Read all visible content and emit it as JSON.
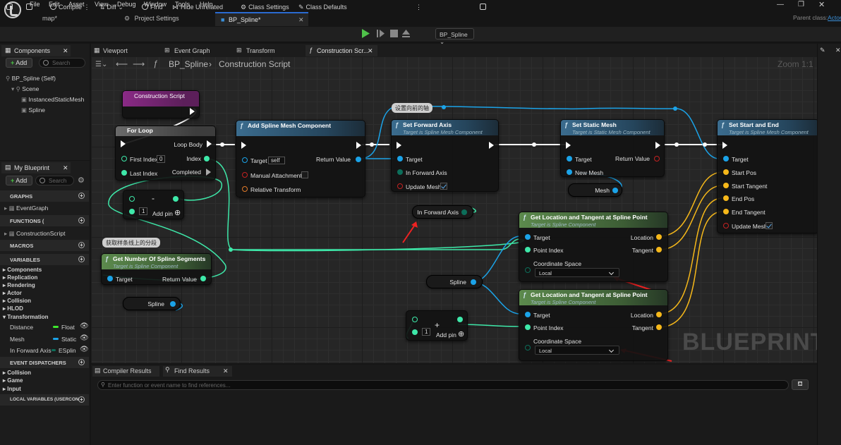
{
  "menu": {
    "items": [
      "File",
      "Edit",
      "Asset",
      "View",
      "Debug",
      "Window",
      "Tools",
      "Help"
    ],
    "parent_class_label": "Parent class:",
    "parent_class_value": "Actor"
  },
  "tabs": {
    "map": "map*",
    "project_settings": "Project Settings",
    "bp_spline": "BP_Spline*"
  },
  "toolbar": {
    "compile": "Compile",
    "diff": "Diff",
    "find": "Find",
    "hide_unrelated": "Hide Unrelated",
    "class_settings": "Class Settings",
    "class_defaults": "Class Defaults",
    "debug_object": "BP_Spline"
  },
  "components_panel": {
    "tab_label": "Components",
    "add_label": "Add",
    "search_placeholder": "Search",
    "tree": [
      "BP_Spline (Self)",
      "Scene",
      "InstancedStaticMesh",
      "Spline"
    ]
  },
  "my_blueprint": {
    "tab_label": "My Blueprint",
    "add_label": "Add",
    "search_placeholder": "Search",
    "graphs_header": "GRAPHS",
    "graphs": [
      "EventGraph"
    ],
    "functions_header": "FUNCTIONS (",
    "functions": [
      "ConstructionScript"
    ],
    "macros_header": "MACROS",
    "variables_header": "VARIABLES",
    "categories": [
      "Components",
      "Replication",
      "Rendering",
      "Actor",
      "Collision",
      "HLOD",
      "Transformation"
    ],
    "variables": [
      {
        "name": "Distance",
        "type": "Float",
        "color": "#3ee82c"
      },
      {
        "name": "Mesh",
        "type": "Static",
        "color": "#1ba3e8"
      },
      {
        "name": "In Forward Axis",
        "type": "ESplin",
        "color": "#0c6e5a"
      }
    ],
    "event_dispatchers_header": "EVENT DISPATCHERS",
    "dispatcher_categories": [
      "Collision",
      "Game",
      "Input"
    ],
    "local_variables_header": "LOCAL VARIABLES (USERCON"
  },
  "editor_tabs": {
    "viewport": "Viewport",
    "event_graph": "Event Graph",
    "transform": "Transform",
    "construction": "Construction Scr..."
  },
  "graph": {
    "breadcrumb_root": "BP_Spline",
    "breadcrumb_leaf": "Construction Script",
    "zoom": "Zoom 1:1",
    "watermark": "BLUEPRINT",
    "comment_set_axis": "设置向前的轴",
    "comment_get_segments": "获取样条线上的分段",
    "nodes": {
      "construction_script": "Construction Script",
      "for_loop": {
        "title": "For Loop",
        "loop_body": "Loop Body",
        "first_index": "First Index",
        "first_index_val": "0",
        "index": "Index",
        "last_index": "Last Index",
        "completed": "Completed"
      },
      "add_spline_mesh": {
        "title": "Add Spline Mesh Component",
        "target": "Target",
        "target_val": "self",
        "return_value": "Return Value",
        "manual_attachment": "Manual Attachment",
        "relative_transform": "Relative Transform"
      },
      "set_forward_axis": {
        "title": "Set Forward Axis",
        "subtitle": "Target is Spline Mesh Component",
        "target": "Target",
        "in_forward_axis": "In Forward Axis",
        "update_mesh": "Update Mesh"
      },
      "set_static_mesh": {
        "title": "Set Static Mesh",
        "subtitle": "Target is Static Mesh Component",
        "target": "Target",
        "new_mesh": "New Mesh",
        "return_value": "Return Value"
      },
      "set_start_end": {
        "title": "Set Start and End",
        "subtitle": "Target is Spline Mesh Component",
        "target": "Target",
        "start_pos": "Start Pos",
        "start_tangent": "Start Tangent",
        "end_pos": "End Pos",
        "end_tangent": "End Tangent",
        "update_mesh": "Update Mesh"
      },
      "get_loc_1": {
        "title": "Get Location and Tangent at Spline Point",
        "subtitle": "Target is Spline Component",
        "target": "Target",
        "location": "Location",
        "point_index": "Point Index",
        "tangent": "Tangent",
        "coord_space": "Coordinate Space",
        "coord_val": "Local"
      },
      "get_loc_2": {
        "title": "Get Location and Tangent at Spline Point",
        "subtitle": "Target is Spline Component",
        "target": "Target",
        "location": "Location",
        "point_index": "Point Index",
        "tangent": "Tangent",
        "coord_space": "Coordinate Space",
        "coord_val": "Local"
      },
      "get_num_segments": {
        "title": "Get Number Of Spline Segments",
        "subtitle": "Target is Spline Component",
        "target": "Target",
        "return_value": "Return Value"
      },
      "add_node_1": {
        "minus": "-",
        "val": "1",
        "add_pin": "Add pin"
      },
      "add_node_2": {
        "plus": "+",
        "val": "1",
        "add_pin": "Add pin"
      },
      "mesh_var": "Mesh",
      "in_forward_axis_var": "In Forward Axis",
      "spline_var_1": "Spline",
      "spline_var_2": "Spline"
    }
  },
  "bottom": {
    "compiler_results": "Compiler Results",
    "find_results": "Find Results",
    "find_placeholder": "Enter function or event name to find references..."
  }
}
